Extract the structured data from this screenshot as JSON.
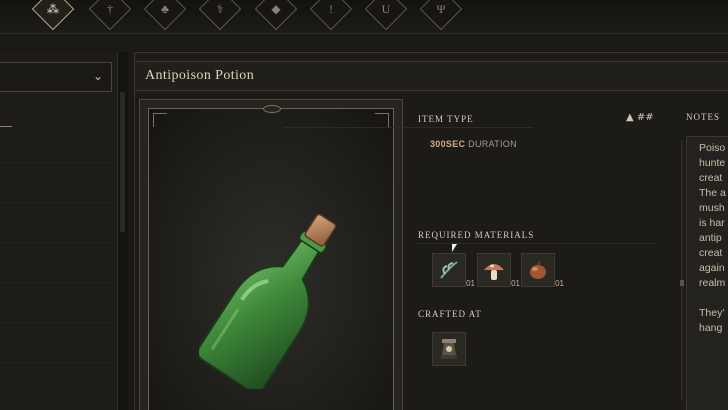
{
  "toolbar": {
    "icons": [
      {
        "name": "cluster-icon",
        "glyph": "⁂",
        "active": true
      },
      {
        "name": "sword-icon",
        "glyph": "†",
        "active": false
      },
      {
        "name": "paw-icon",
        "glyph": "♣",
        "active": false
      },
      {
        "name": "staff-icon",
        "glyph": "⚕",
        "active": false
      },
      {
        "name": "gem-icon",
        "glyph": "◆",
        "active": false
      },
      {
        "name": "spire-icon",
        "glyph": "!",
        "active": false
      },
      {
        "name": "horseshoe-icon",
        "glyph": "U",
        "active": false
      },
      {
        "name": "trident-icon",
        "glyph": "Ψ",
        "active": false
      }
    ]
  },
  "sidebar": {
    "dropdown_chevron": "⌄"
  },
  "item": {
    "title": "Antipoison Potion",
    "item_type_label": "ITEM TYPE",
    "item_type_marks": "▲  ##",
    "duration_value": "300SEC",
    "duration_unit": "DURATION",
    "required_materials_label": "REQUIRED MATERIALS",
    "materials": [
      {
        "icon": "herb-icon",
        "qty": "01"
      },
      {
        "icon": "mushroom-icon",
        "qty": "01"
      },
      {
        "icon": "seed-icon",
        "qty": "01"
      }
    ],
    "crafted_at_label": "CRAFTED AT",
    "crafted_at_icon": "alchemy-station-icon"
  },
  "notes": {
    "label": "NOTES",
    "lines": [
      "Poiso",
      "hunte",
      "creat",
      "The a",
      "mush",
      "is har",
      "antip",
      "creat",
      "again",
      "realm",
      "",
      "They'",
      "hang"
    ]
  },
  "colors": {
    "background": "#1a1916",
    "panel": "#1c1b18",
    "text": "#cfc6b0",
    "accent_duration": "#d3a985",
    "bottle_green": "#3e8a3a"
  }
}
